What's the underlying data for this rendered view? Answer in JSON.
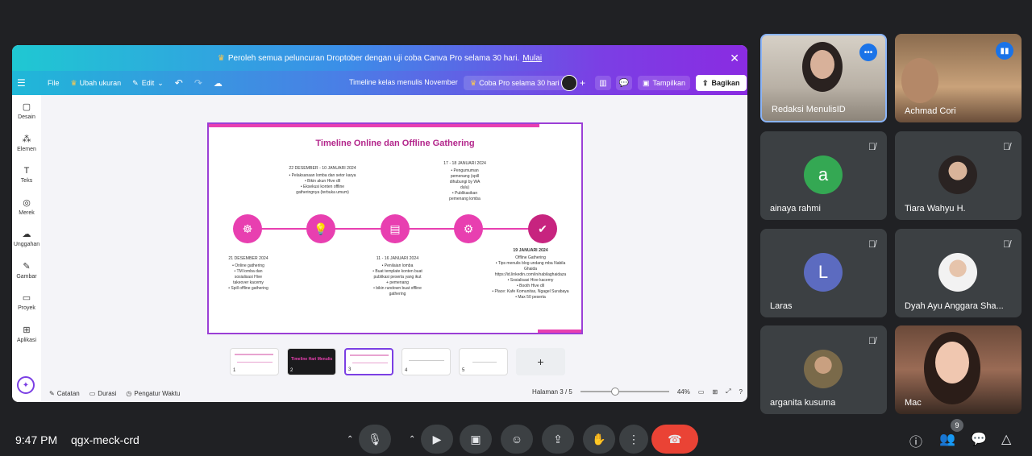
{
  "canva": {
    "promo_text": "Peroleh semua peluncuran Droptober dengan uji coba Canva Pro selama 30 hari.",
    "promo_link": "Mulai",
    "menu_file": "File",
    "resize": "Ubah ukuran",
    "edit": "Edit",
    "doc_title": "Timeline kelas menulis November",
    "pro_trial": "Coba Pro selama 30 hari",
    "present": "Tampilkan",
    "share": "Bagikan",
    "sidebar": [
      "Desain",
      "Elemen",
      "Teks",
      "Merek",
      "Unggahan",
      "Gambar",
      "Proyek",
      "Aplikasi"
    ],
    "notes": "Catatan",
    "duration": "Durasi",
    "timer": "Pengatur Waktu",
    "page_indicator": "Halaman 3 / 5",
    "zoom": "44%",
    "thumb_nums": [
      "1",
      "2",
      "3",
      "4",
      "5"
    ],
    "thumb2_text": "Timeline Hari Menulis"
  },
  "slide": {
    "title": "Timeline Online dan Offline Gathering",
    "top1_head": "22 DESEMBER - 10 JANUARI 2024",
    "top1_lines": [
      "• Pelaksanaan lomba dan setor karya",
      "• Bikin akun Hive dll",
      "• Eksekusi konten offline",
      "gatheringnya (terbuka umum)"
    ],
    "top2_head": "17 - 18 JANUARI 2024",
    "top2_lines": [
      "• Pengumuman",
      "pemenang (spill",
      "dihubungi by WA",
      "dulu)",
      "• Publikasikan",
      "pemenang lomba"
    ],
    "bot1_head": "21 DESEMBER 2024",
    "bot1_lines": [
      "• Online gathering",
      "• TM lomba dan",
      "sosialisasi Hive",
      "takeover kacemy",
      "• Spill offline gathering"
    ],
    "bot2_head": "11 - 16 JANUARI 2024",
    "bot2_lines": [
      "• Penilaian lomba",
      "• Buat template konten buat",
      "publikasi peserta yang ikut",
      "+ pemenang",
      "• bikin rundown buat offline",
      "gathering"
    ],
    "bot3_head": "19 JANUARI 2024",
    "bot3_lines": [
      "Offline Gathering",
      "• Tips menulis blog undang mba Nabila",
      "Ghaida",
      "https://id.linkedin.com/in/nabilaghaidaza",
      "• Sosialisasi Hive kacemy",
      "• Booth Hive dll",
      "• Place: Kafe Komunitas, Ngagel Surabaya",
      "• Max 50 peserta"
    ]
  },
  "participants": [
    {
      "name": "Redaksi MenulisID"
    },
    {
      "name": "Achmad Cori"
    },
    {
      "name": "ainaya rahmi",
      "initial": "a",
      "color": "#34a853"
    },
    {
      "name": "Tiara Wahyu H."
    },
    {
      "name": "Laras",
      "initial": "L",
      "color": "#5c6bc0"
    },
    {
      "name": "Dyah Ayu Anggara Sha..."
    },
    {
      "name": "arganita kusuma"
    },
    {
      "name": "Mac"
    }
  ],
  "meet": {
    "time": "9:47 PM",
    "code": "qgx-meck-crd",
    "people_count": "9"
  }
}
